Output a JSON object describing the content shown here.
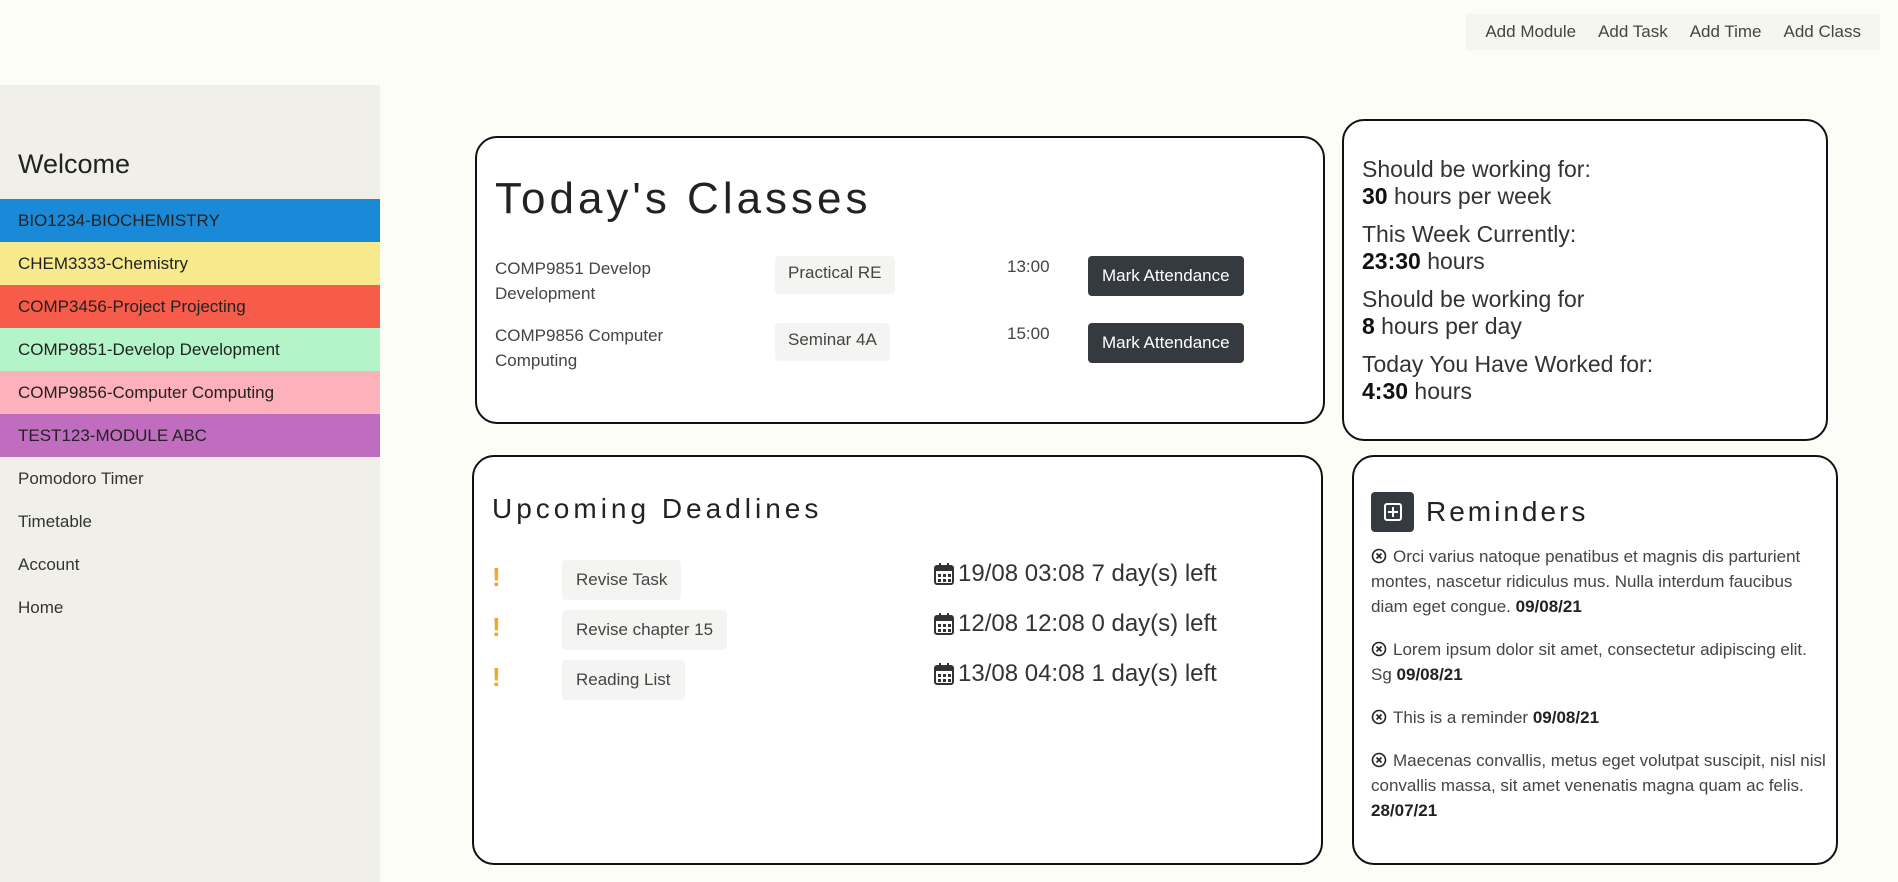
{
  "topnav": {
    "items": [
      "Add Module",
      "Add Task",
      "Add Time",
      "Add Class"
    ]
  },
  "sidebar": {
    "welcome": "Welcome",
    "modules": [
      {
        "label": "BIO1234-BIOCHEMISTRY",
        "color": "#1a8ad8"
      },
      {
        "label": "CHEM3333-Chemistry",
        "color": "#f7ea8c"
      },
      {
        "label": "COMP3456-Project Projecting",
        "color": "#f75b4a"
      },
      {
        "label": "COMP9851-Develop Development",
        "color": "#b3f5c9"
      },
      {
        "label": "COMP9856-Computer Computing",
        "color": "#fdb1ba"
      },
      {
        "label": "TEST123-MODULE ABC",
        "color": "#c06dbf"
      }
    ],
    "links": [
      "Pomodoro Timer",
      "Timetable",
      "Account",
      "Home"
    ]
  },
  "classes": {
    "title": "Today's Classes",
    "rows": [
      {
        "name": "COMP9851 Develop Development",
        "room": "Practical RE",
        "time": "13:00",
        "action": "Mark Attendance"
      },
      {
        "name": "COMP9856 Computer Computing",
        "room": "Seminar 4A",
        "time": "15:00",
        "action": "Mark Attendance"
      }
    ]
  },
  "stats": {
    "s1_label": "Should be working for:",
    "s1_value": "30",
    "s1_unit": " hours per week",
    "s2_label": "This Week Currently:",
    "s2_value": "23:30",
    "s2_unit": " hours",
    "s3_label": "Should be working for",
    "s3_value": "8",
    "s3_unit": " hours per day",
    "s4_label": "Today You Have Worked for:",
    "s4_value": "4:30",
    "s4_unit": " hours"
  },
  "deadlines": {
    "title": "Upcoming Deadlines",
    "rows": [
      {
        "task": "Revise Task",
        "due": "19/08 03:08 7 day(s) left"
      },
      {
        "task": "Revise chapter 15",
        "due": "12/08 12:08 0 day(s) left"
      },
      {
        "task": "Reading List",
        "due": "13/08 04:08 1 day(s) left"
      }
    ]
  },
  "reminders": {
    "title": "Reminders",
    "items": [
      {
        "text": "Orci varius natoque penatibus et magnis dis parturient montes, nascetur ridiculus mus. Nulla interdum faucibus diam eget congue.",
        "date": "09/08/21"
      },
      {
        "text": "Lorem ipsum dolor sit amet, consectetur adipiscing elit. Sg",
        "date": "09/08/21"
      },
      {
        "text": "This is a reminder",
        "date": "09/08/21"
      },
      {
        "text": "Maecenas convallis, metus eget volutpat suscipit, nisl nisl convallis massa, sit amet venenatis magna quam ac felis.",
        "date": "28/07/21"
      }
    ]
  },
  "colors": {
    "accent_dark": "#343a40",
    "warning": "#f5a623"
  },
  "icons": [
    "exclamation-icon",
    "calendar-icon",
    "plus-square-icon",
    "close-circle-icon"
  ]
}
